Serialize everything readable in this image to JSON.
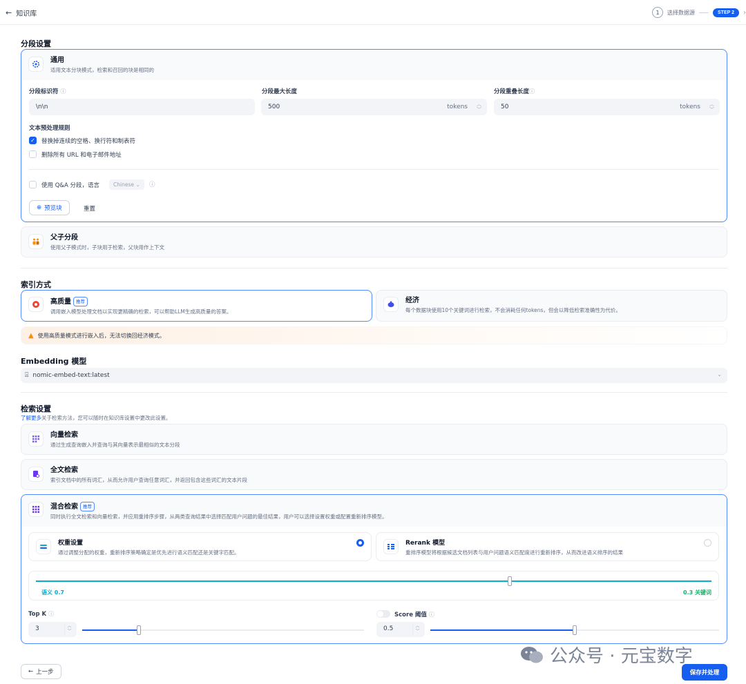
{
  "topbar": {
    "back_label": "知识库",
    "steps": [
      {
        "num": "1",
        "label": "选择数据源"
      },
      {
        "badge": "STEP 2"
      }
    ]
  },
  "segmentation": {
    "section_title": "分段设置",
    "general": {
      "title": "通用",
      "desc": "适用文本分块模式，检索和召回的块是相同的"
    },
    "separator": {
      "label": "分段标识符",
      "value": "\\n\\n"
    },
    "max_length": {
      "label": "分段最大长度",
      "value": "500",
      "unit": "tokens"
    },
    "overlap": {
      "label": "分段重叠长度",
      "value": "50",
      "unit": "tokens"
    },
    "preprocess_title": "文本预处理规则",
    "rule1": {
      "label": "替换掉连续的空格、换行符和制表符",
      "checked": true
    },
    "rule2": {
      "label": "删除所有 URL 和电子邮件地址",
      "checked": false
    },
    "qa": {
      "label": "使用 Q&A 分段，语言",
      "language": "Chinese"
    },
    "preview_button": "预览块",
    "reset_button": "重置",
    "parent_child": {
      "title": "父子分段",
      "desc": "使用父子模式时，子块用于检索，父块用作上下文"
    }
  },
  "index": {
    "section_title": "索引方式",
    "high_quality": {
      "title": "高质量",
      "tag": "推荐",
      "desc": "调用嵌入模型处理文档以实现更精确的检索，可以帮助LLM生成高质量的答案。"
    },
    "economy": {
      "title": "经济",
      "desc": "每个数据块使用10个关键词进行检索，不会消耗任何tokens，但会以降低检索准确性为代价。"
    },
    "warning": "使用高质量模式进行嵌入后，无法切换回经济模式。"
  },
  "embedding": {
    "section_title": "Embedding 模型",
    "model": "nomic-embed-text:latest"
  },
  "retrieval": {
    "section_title": "检索设置",
    "learn_more": "了解更多",
    "hint": "关于检索方法，您可以随时在知识库设置中更改此设置。",
    "vector": {
      "title": "向量检索",
      "desc": "通过生成查询嵌入并查询与其向量表示最相似的文本分段"
    },
    "fulltext": {
      "title": "全文检索",
      "desc": "索引文档中的所有词汇，从而允许用户查询任意词汇，并返回包含这些词汇的文本片段"
    },
    "hybrid": {
      "title": "混合检索",
      "tag": "推荐",
      "desc": "同时执行全文检索和向量检索，并应用重排序步骤，从两类查询结果中选择匹配用户问题的最佳结果，用户可以选择设置权重或配置重新排序模型。"
    },
    "weights": {
      "title": "权重设置",
      "desc": "通过调整分配的权重，重新排序策略确定是优先进行语义匹配还是关键字匹配。",
      "selected": true
    },
    "rerank": {
      "title": "Rerank 模型",
      "desc": "重排序模型将根据候选文档列表与用户问题语义匹配度进行重新排序，从而改进语义排序的结果",
      "selected": false
    },
    "semantic_label": "语义 0.7",
    "keyword_label": "0.3 关键词",
    "semantic_weight": 0.7,
    "topk": {
      "label": "Top K",
      "value": "3",
      "fraction": 0.2
    },
    "score": {
      "label": "Score 阈值",
      "value": "0.5",
      "fraction": 0.5,
      "enabled": false
    }
  },
  "footer": {
    "prev_button": "上一步",
    "save_button": "保存并处理"
  },
  "watermark": "公众号 · 元宝数字",
  "colors": {
    "primary": "#155eef",
    "semantic": "#06aed4",
    "keyword": "#17b26a",
    "warning": "#f79009"
  }
}
